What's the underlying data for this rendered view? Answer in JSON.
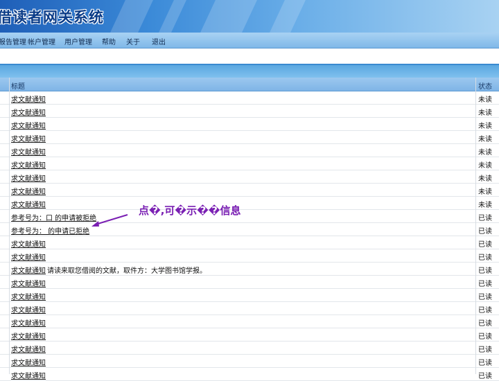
{
  "header": {
    "title": "借读者网关系统"
  },
  "menu": {
    "items": [
      "报告管理",
      "帐户管理",
      "用户管理",
      "帮助",
      "关于",
      "退出"
    ]
  },
  "table": {
    "headers": {
      "title": "标题",
      "status": "状态"
    },
    "rows": [
      {
        "title": "求文献通知",
        "extra": "",
        "status": "未读"
      },
      {
        "title": "求文献通知",
        "extra": "",
        "status": "未读"
      },
      {
        "title": "求文献通知",
        "extra": "",
        "status": "未读"
      },
      {
        "title": "求文献通知",
        "extra": "",
        "status": "未读"
      },
      {
        "title": "求文献通知",
        "extra": "",
        "status": "未读"
      },
      {
        "title": "求文献通知",
        "extra": "",
        "status": "未读"
      },
      {
        "title": "求文献通知",
        "extra": "",
        "status": "未读"
      },
      {
        "title": "求文献通知",
        "extra": "",
        "status": "未读"
      },
      {
        "title": "求文献通知",
        "extra": "",
        "status": "未读"
      },
      {
        "title": "参考号为：口 的申请被拒绝",
        "extra": "",
        "status": "已读"
      },
      {
        "title": "参考号为： 的申请已拒绝",
        "extra": "",
        "status": "已读"
      },
      {
        "title": "求文献通知",
        "extra": "",
        "status": "已读"
      },
      {
        "title": "求文献通知",
        "extra": "",
        "status": "已读"
      },
      {
        "title": "求文献通知",
        "extra": "请读来取您借阅的文献，取件方：大学图书馆学报。",
        "status": "已读"
      },
      {
        "title": "求文献通知",
        "extra": "",
        "status": "已读"
      },
      {
        "title": "求文献通知",
        "extra": "",
        "status": "已读"
      },
      {
        "title": "求文献通知",
        "extra": "",
        "status": "已读"
      },
      {
        "title": "求文献通知",
        "extra": "",
        "status": "已读"
      },
      {
        "title": "求文献通知",
        "extra": "",
        "status": "已读"
      },
      {
        "title": "求文献通知",
        "extra": "",
        "status": "已读"
      },
      {
        "title": "求文献通知",
        "extra": "",
        "status": "已读"
      },
      {
        "title": "求文献通知",
        "extra": "",
        "status": "已读"
      }
    ]
  },
  "annotation": {
    "text": "点�,可�示��信息"
  },
  "colors": {
    "annotation": "#7a1fb3",
    "menubar": "#a9d2f3",
    "header_band": "#1f5fb8"
  }
}
